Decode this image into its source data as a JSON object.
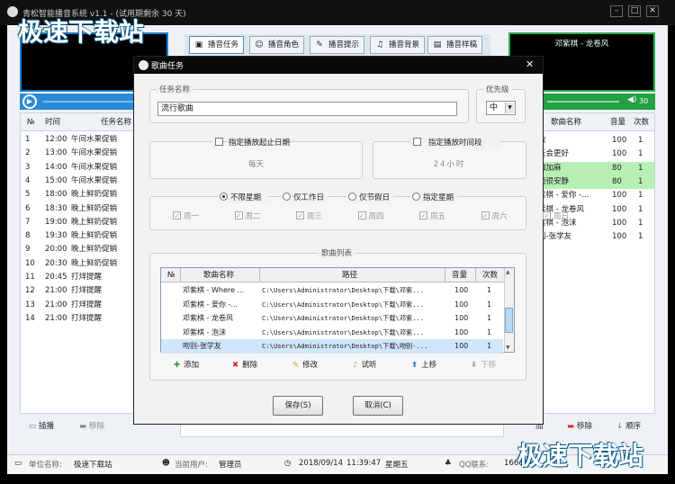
{
  "app": {
    "title": "青松智能播音系统 v1.1 - (试用期剩余 30 天)",
    "min": "–",
    "max": "□",
    "close": "✕"
  },
  "watermark": {
    "text": "极速下载站"
  },
  "tabs": [
    {
      "label": "播音任务",
      "icon": "▣"
    },
    {
      "label": "播音角色",
      "icon": "☺"
    },
    {
      "label": "播音提示",
      "icon": "✎"
    },
    {
      "label": "播音背景",
      "icon": "♫"
    },
    {
      "label": "播音样稿",
      "icon": "▤"
    }
  ],
  "right_screen": {
    "text": "邓紫棋 - 龙卷风",
    "volume": "30"
  },
  "left_list": {
    "headers": [
      "№",
      "时间",
      "任务名称"
    ],
    "rows": [
      {
        "n": "1",
        "t": "12:00",
        "name": "午间水果促销"
      },
      {
        "n": "2",
        "t": "13:00",
        "name": "午间水果促销"
      },
      {
        "n": "3",
        "t": "14:00",
        "name": "午间水果促销"
      },
      {
        "n": "4",
        "t": "15:00",
        "name": "午间水果促销"
      },
      {
        "n": "5",
        "t": "18:00",
        "name": "晚上鲜奶促销"
      },
      {
        "n": "6",
        "t": "18:30",
        "name": "晚上鲜奶促销"
      },
      {
        "n": "7",
        "t": "19:00",
        "name": "晚上鲜奶促销"
      },
      {
        "n": "8",
        "t": "19:30",
        "name": "晚上鲜奶促销"
      },
      {
        "n": "9",
        "t": "20:00",
        "name": "晚上鲜奶促销"
      },
      {
        "n": "10",
        "t": "20:30",
        "name": "晚上鲜奶促销"
      },
      {
        "n": "11",
        "t": "20:45",
        "name": "打烊提醒"
      },
      {
        "n": "12",
        "t": "21:00",
        "name": "打烊提醒"
      },
      {
        "n": "13",
        "t": "21:00",
        "name": "打烊提醒"
      },
      {
        "n": "14",
        "t": "21:00",
        "name": "打烊提醒"
      }
    ]
  },
  "right_list": {
    "headers": [
      "歌曲名称",
      "音量",
      "次数"
    ],
    "rows": [
      {
        "name": "敢",
        "v": "100",
        "c": "1"
      },
      {
        "name": "天会更好",
        "v": "100",
        "c": "1"
      },
      {
        "name": "咖加麻",
        "v": "80",
        "c": "1"
      },
      {
        "name": "面很安静",
        "v": "80",
        "c": "1"
      },
      {
        "name": "紫棋 - 爱你 -...",
        "v": "100",
        "c": "1"
      },
      {
        "name": "紫棋 - 龙卷风",
        "v": "100",
        "c": "1"
      },
      {
        "name": "紫棋 - 泡沫",
        "v": "100",
        "c": "1"
      },
      {
        "name": "别-张学友",
        "v": "100",
        "c": "1"
      }
    ]
  },
  "left_toolbar": {
    "insert": "插播",
    "remove": "移除"
  },
  "right_toolbar": {
    "add": "加",
    "remove": "移除",
    "order": "顺序"
  },
  "status": {
    "unit_label": "单位名称:",
    "unit": "极速下载站",
    "user_label": "当前用户:",
    "user": "管理员",
    "date": "2018/09/14",
    "time": "11:39:47",
    "weekday": "星期五",
    "qq_label": "QQ联系:",
    "qq": "16603"
  },
  "dialog": {
    "title": "歌曲任务",
    "task_name_label": "任务名称",
    "task_name": "流行歌曲",
    "priority_label": "优先级",
    "priority": "中",
    "date_range_label": "指定播放起止日期",
    "date_range_value": "每天",
    "time_range_label": "指定播放时间段",
    "time_range_value": "24小时",
    "day_modes": [
      "不限星期",
      "仅工作日",
      "仅节假日",
      "指定星期"
    ],
    "weekdays": [
      "周一",
      "周二",
      "周三",
      "周四",
      "周五",
      "周六",
      "周日"
    ],
    "song_list_label": "歌曲列表",
    "song_headers": [
      "№",
      "歌曲名称",
      "路径",
      "音量",
      "次数"
    ],
    "songs": [
      {
        "name": "邓紫棋 - Where ...",
        "path": "C:\\Users\\Administrator\\Desktop\\下载\\邓紫...",
        "v": "100",
        "c": "1"
      },
      {
        "name": "邓紫棋 - 爱你 -...",
        "path": "C:\\Users\\Administrator\\Desktop\\下载\\邓紫...",
        "v": "100",
        "c": "1"
      },
      {
        "name": "邓紫棋 - 龙卷风",
        "path": "C:\\Users\\Administrator\\Desktop\\下载\\邓紫...",
        "v": "100",
        "c": "1"
      },
      {
        "name": "邓紫棋 - 泡沫",
        "path": "C:\\Users\\Administrator\\Desktop\\下载\\邓紫...",
        "v": "100",
        "c": "1"
      },
      {
        "name": "吻别-张学友",
        "path": "C:\\Users\\Administrator\\Desktop\\下载\\吻别-...",
        "v": "100",
        "c": "1"
      }
    ],
    "toolbar": {
      "add": "添加",
      "delete": "删除",
      "edit": "修改",
      "listen": "试听",
      "up": "上移",
      "down": "下移"
    },
    "save": "保存(S)",
    "cancel": "取消(C)"
  },
  "colors": {
    "accent": "#1a7fd0",
    "green": "#2cb04a",
    "highlight": "#b8f0b4",
    "selection": "#cfe6fb"
  }
}
